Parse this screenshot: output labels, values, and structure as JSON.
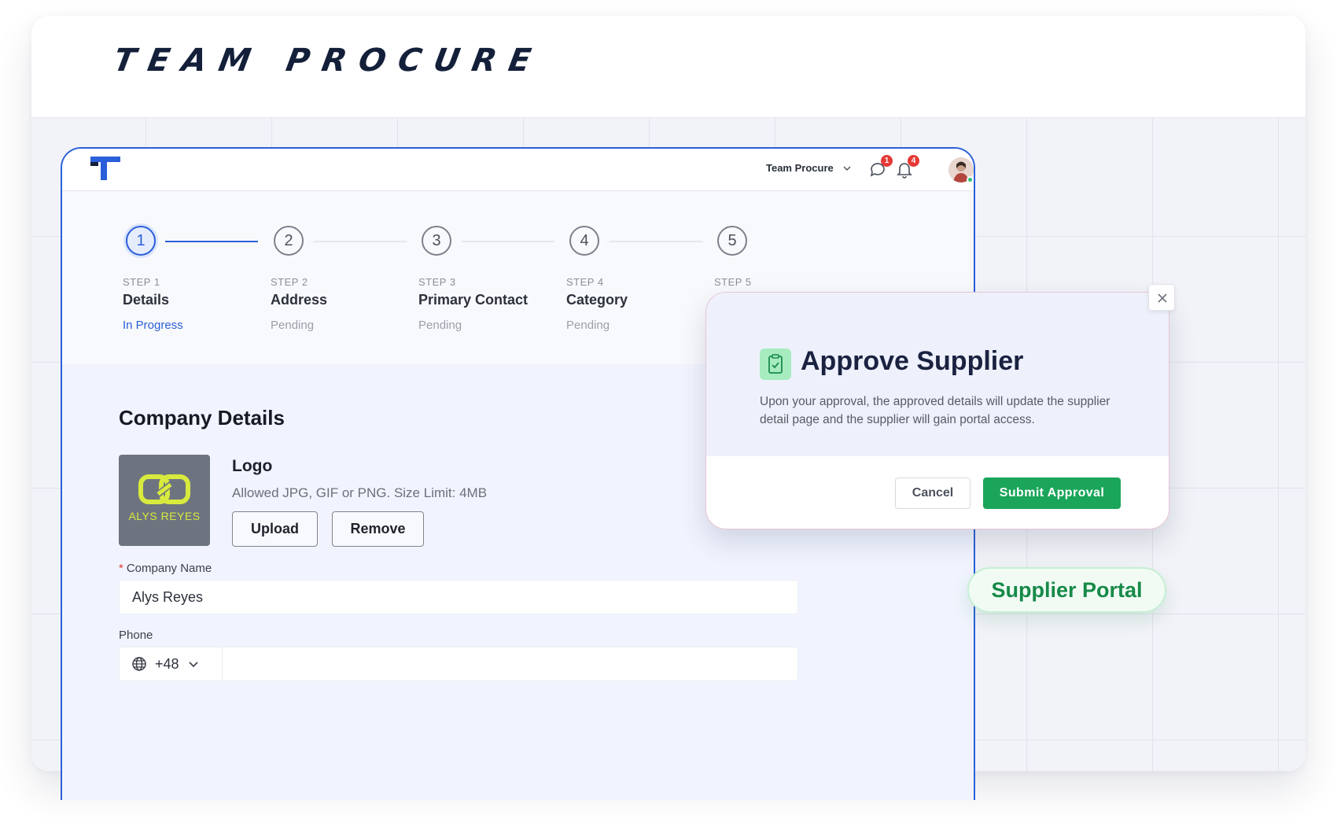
{
  "brand": {
    "title": "TEAM PROCURE"
  },
  "topbar": {
    "workspace": "Team Procure",
    "chat_badge": "1",
    "notif_badge": "4"
  },
  "steps": [
    {
      "number": "1",
      "step_label": "STEP 1",
      "title": "Details",
      "status": "In Progress",
      "active": true
    },
    {
      "number": "2",
      "step_label": "STEP 2",
      "title": "Address",
      "status": "Pending",
      "active": false
    },
    {
      "number": "3",
      "step_label": "STEP 3",
      "title": "Primary Contact",
      "status": "Pending",
      "active": false
    },
    {
      "number": "4",
      "step_label": "STEP 4",
      "title": "Category",
      "status": "Pending",
      "active": false
    },
    {
      "number": "5",
      "step_label": "STEP 5",
      "title": "",
      "status": "",
      "active": false
    }
  ],
  "form": {
    "section_title": "Company Details",
    "logo_brand_text": "ALYS REYES",
    "logo_label": "Logo",
    "logo_hint": "Allowed JPG, GIF or PNG. Size Limit: 4MB",
    "upload_label": "Upload",
    "remove_label": "Remove",
    "company_required_mark": "*",
    "company_name_label": "Company Name",
    "company_name_value": "Alys Reyes",
    "phone_label": "Phone",
    "phone_prefix": "+48",
    "phone_value": ""
  },
  "modal": {
    "title": "Approve Supplier",
    "text": "Upon your approval, the approved details will update the supplier detail page and the supplier will gain portal access.",
    "cancel_label": "Cancel",
    "submit_label": "Submit Approval"
  },
  "portal_label": "Supplier Portal",
  "colors": {
    "accent": "#2b5fd9",
    "success": "#1aa55a",
    "badge": "#e53935"
  }
}
